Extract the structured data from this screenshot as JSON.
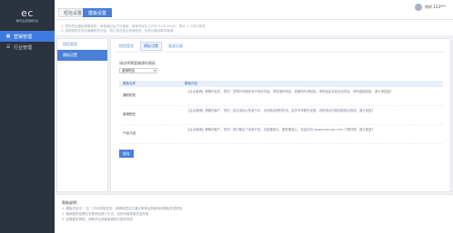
{
  "sidebar": {
    "logo_mark": "ec",
    "logo_text": "腾讯企点营销平台",
    "items": [
      {
        "label": "营销管理",
        "icon": "grid-icon",
        "active": true
      },
      {
        "label": "行业管理",
        "icon": "list-icon",
        "active": false
      }
    ]
  },
  "topbar": {
    "tabs": [
      {
        "label": "短信设置",
        "active": false
      },
      {
        "label": "模板设置",
        "active": true
      }
    ],
    "user": "你好 123***"
  },
  "notice": {
    "line1": "1. 短信签名模板需要审核，审核通过后方可使用，审核时间为工作日 9:00-18:00，预计 2 小时内完成",
    "line2": "2. 请按照相关规定编辑短信内容，禁止发送违法违规信息，如有问题请联系客服"
  },
  "left_panel": {
    "items": [
      {
        "label": "短信类型",
        "active": false
      },
      {
        "label": "模板设置",
        "active": true
      }
    ]
  },
  "main": {
    "subtabs": [
      {
        "label": "短信签名",
        "active": false
      },
      {
        "label": "模板设置",
        "active": true
      },
      {
        "label": "发送记录",
        "active": false
      }
    ],
    "form_label": "请选择需要编辑的模板",
    "form_select": "营销短信",
    "table_header": {
      "col1": "模板名称",
      "col2": "模板内容"
    },
    "rows": [
      {
        "name": "通知短信",
        "content": "【企点营销】尊敬的会员，您好！您预约的服务将于明天开始，请您准时到店，如需改约请回复，本短信由系统自动发送，请勿直接回复，退订请回复T"
      },
      {
        "name": "营销短信",
        "content": "【企点营销】尊敬的客户，您好！店庆活动火热进行中，全场商品限时折扣，会员专享额外优惠，详情请访问官网或到店咨询，退订回复T"
      },
      {
        "name": "产品介绍",
        "content": "【企点营销】尊敬的客户，您好！我们推出了全新产品，功能更强大，服务更贴心，欢迎访问 www.example.com 了解详情，退订回复T"
      }
    ],
    "save_label": "保存"
  },
  "help": {
    "title": "帮助说明：",
    "lines": [
      "1. 模板内容中 \"【】\" 内为短信签名，请确保签名已通过审核后再使用该模板发送短信",
      "2. 营销类短信需在末尾添加退订方式，否则可能导致发送失败",
      "3. 如需更多帮助，请联系在线客服或拨打服务热线"
    ]
  }
}
